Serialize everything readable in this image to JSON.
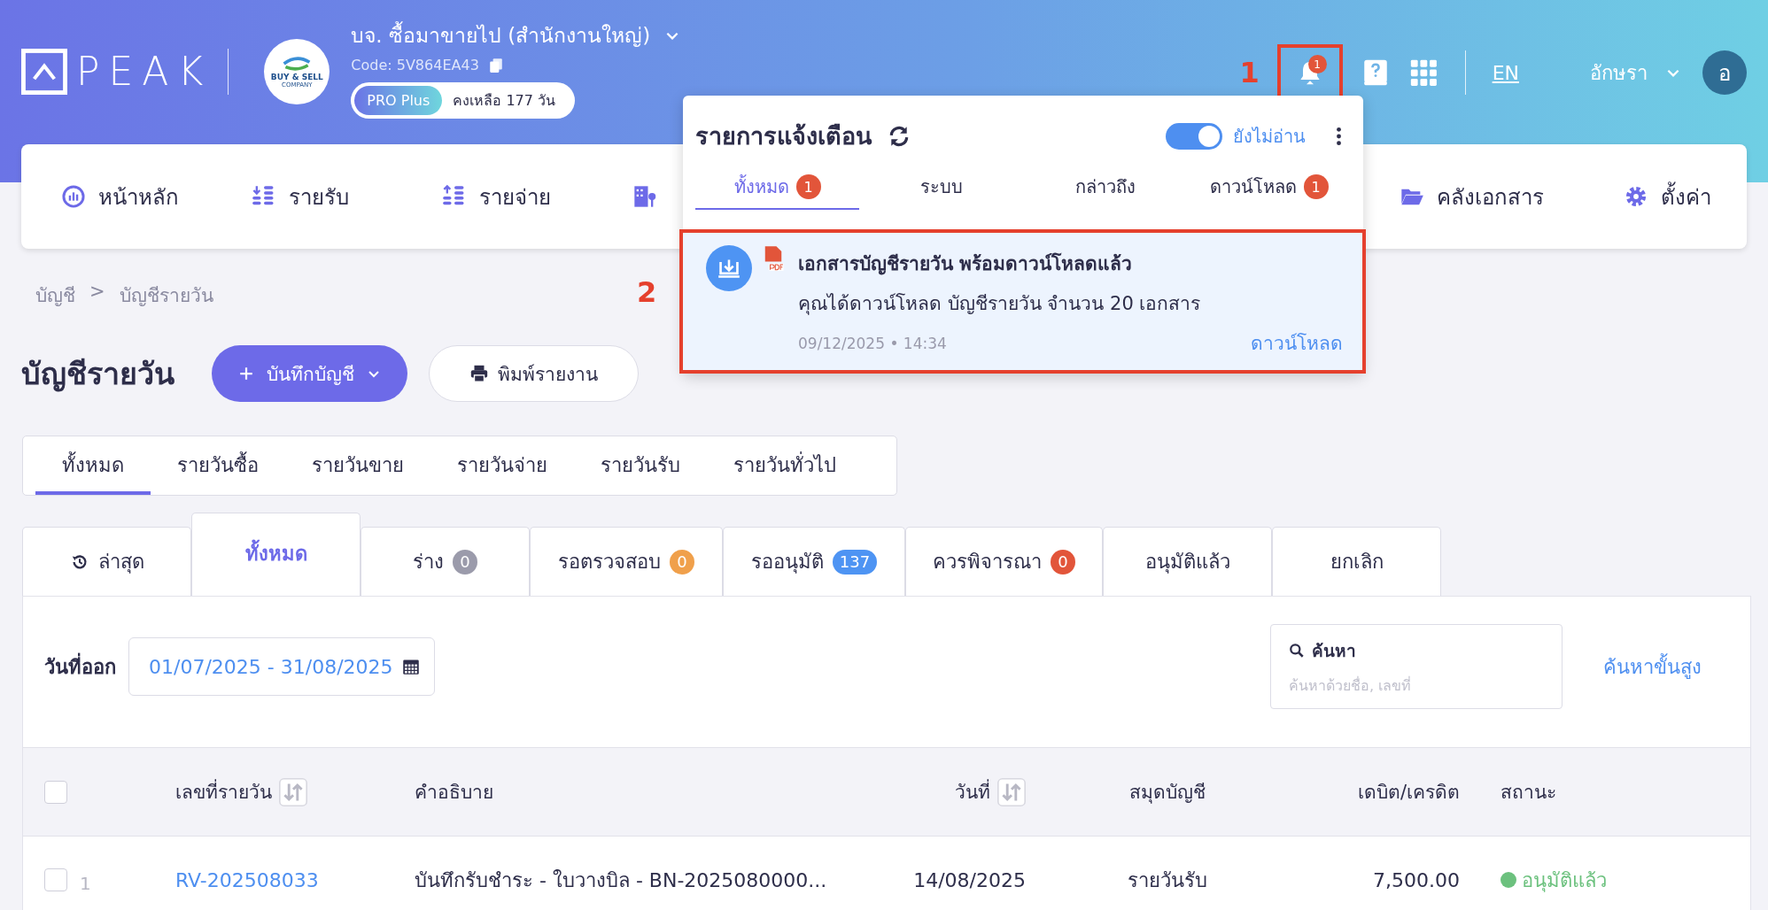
{
  "brand": {
    "logo": "PEAK"
  },
  "company": {
    "name": "บจ. ซื้อมาขายไป (สำนักงานใหญ่)",
    "code": "Code: 5V864EA43",
    "logo_lines": [
      "BUY & SELL",
      "COMPANY"
    ],
    "plan": "PRO Plus",
    "remaining": "คงเหลือ 177 วัน"
  },
  "header": {
    "bell_badge": "1",
    "language": "EN",
    "user": "อักษรา",
    "avatar": "อ"
  },
  "nav": [
    {
      "label": "หน้าหลัก",
      "kind": "dashboard"
    },
    {
      "label": "รายรับ",
      "kind": "income"
    },
    {
      "label": "รายจ่าย",
      "kind": "expense"
    },
    {
      "kind": "building"
    },
    {
      "label": "คลังเอกสาร",
      "kind": "folder"
    },
    {
      "label": "ตั้งค่า",
      "kind": "gear"
    }
  ],
  "breadcrumb": [
    "บัญชี",
    ">",
    "บัญชีรายวัน"
  ],
  "page_title": "บัญชีรายวัน",
  "buttons": {
    "primary": "บันทึกบัญชี",
    "print": "พิมพ์รายงาน"
  },
  "journal_tabs": [
    {
      "label": "ทั้งหมด",
      "selected": true
    },
    {
      "label": "รายวันซื้อ",
      "selected": false
    },
    {
      "label": "รายวันขาย",
      "selected": false
    },
    {
      "label": "รายวันจ่าย",
      "selected": false
    },
    {
      "label": "รายวันรับ",
      "selected": false
    },
    {
      "label": "รายวันทั่วไป",
      "selected": false
    }
  ],
  "status_tabs": [
    {
      "label": "ล่าสุด",
      "kind": "history",
      "selected": false
    },
    {
      "label": "ทั้งหมด",
      "kind": "plain",
      "selected": true
    },
    {
      "label": "ร่าง",
      "kind": "count",
      "count": "0",
      "color": "#9b9bab",
      "selected": false
    },
    {
      "label": "รอตรวจสอบ",
      "kind": "count",
      "count": "0",
      "color": "#f0a04b",
      "selected": false
    },
    {
      "label": "รออนุมัติ",
      "kind": "count",
      "count": "137",
      "color": "#4e94f3",
      "selected": false
    },
    {
      "label": "ควรพิจารณา",
      "kind": "count",
      "count": "0",
      "color": "#e2553a",
      "selected": false
    },
    {
      "label": "อนุมัติแล้ว",
      "kind": "plain",
      "selected": false
    },
    {
      "label": "ยกเลิก",
      "kind": "plain",
      "selected": false
    }
  ],
  "filters": {
    "date_label": "วันที่ออก",
    "date_value": "01/07/2025 - 31/08/2025",
    "search_label": "ค้นหา",
    "search_placeholder": "ค้นหาด้วยชื่อ, เลขที่",
    "advanced": "ค้นหาขั้นสูง"
  },
  "table": {
    "select_all_checked": false,
    "columns": [
      {
        "label": "เลขที่รายวัน",
        "sortable": true
      },
      {
        "label": "คำอธิบาย",
        "sortable": false
      },
      {
        "label": "วันที่",
        "sortable": true
      },
      {
        "label": "สมุดบัญชี",
        "sortable": false
      },
      {
        "label": "เดบิต/เครดิต",
        "sortable": false
      },
      {
        "label": "สถานะ",
        "sortable": false
      }
    ],
    "rows": [
      {
        "checked": false,
        "index": "1",
        "number": "RV-202508033",
        "description": "บันทึกรับชำระ - ใบวางบิล - BN-2025080000...",
        "date": "14/08/2025",
        "book": "รายวันรับ",
        "amount": "7,500.00",
        "status": "อนุมัติแล้ว",
        "color": "#6cc17e"
      }
    ]
  },
  "notifications": {
    "title": "รายการแจ้งเตือน",
    "unread_only": {
      "label": "ยังไม่อ่าน",
      "on": true
    },
    "tabs": [
      {
        "label": "ทั้งหมด",
        "badge": "1",
        "selected": true
      },
      {
        "label": "ระบบ",
        "selected": false
      },
      {
        "label": "กล่าวถึง",
        "selected": false
      },
      {
        "label": "ดาวน์โหลด",
        "badge": "1",
        "selected": false
      }
    ],
    "items": [
      {
        "title": "เอกสารบัญชีรายวัน พร้อมดาวน์โหลดแล้ว",
        "body": "คุณได้ดาวน์โหลด บัญชีรายวัน จำนวน 20 เอกสาร",
        "time": "09/12/2025 • 14:34",
        "action": "ดาวน์โหลด",
        "unread": true
      }
    ]
  },
  "annotations": [
    {
      "label": "1"
    },
    {
      "label": "2"
    }
  ]
}
